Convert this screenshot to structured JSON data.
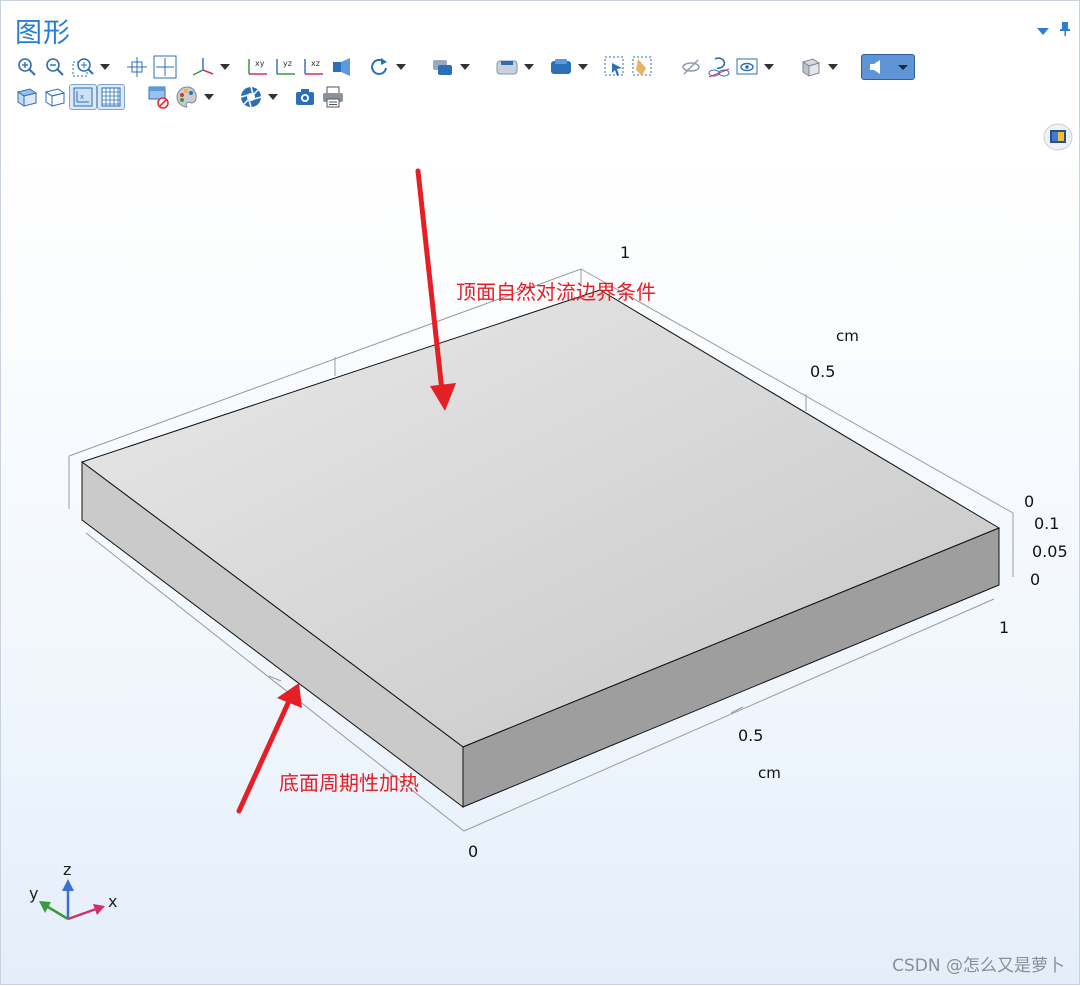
{
  "window": {
    "title": "图形"
  },
  "toolbar": {
    "row1": [
      {
        "name": "zoom-in-icon",
        "dropdown": false
      },
      {
        "name": "zoom-out-icon",
        "dropdown": false
      },
      {
        "name": "zoom-box-icon",
        "dropdown": true
      },
      {
        "name": "zoom-extents-icon",
        "dropdown": false
      },
      {
        "name": "zoom-to-selection-icon",
        "dropdown": false
      },
      {
        "name": "view-axes-icon",
        "dropdown": true
      },
      {
        "name": "view-xy-icon",
        "dropdown": false
      },
      {
        "name": "view-yz-icon",
        "dropdown": false
      },
      {
        "name": "view-xz-icon",
        "dropdown": false
      },
      {
        "name": "perspective-icon",
        "dropdown": false
      },
      {
        "name": "rotate-icon",
        "dropdown": true
      },
      {
        "name": "select-objects-icon",
        "dropdown": true
      },
      {
        "name": "select-boundaries-icon",
        "dropdown": true
      },
      {
        "name": "select-domains-icon",
        "dropdown": true
      },
      {
        "name": "box-select-icon",
        "dropdown": false
      },
      {
        "name": "clear-selection-icon",
        "dropdown": false
      },
      {
        "name": "hide-icon",
        "dropdown": false
      },
      {
        "name": "reset-hiding-icon",
        "dropdown": false
      },
      {
        "name": "show-icon",
        "dropdown": true
      },
      {
        "name": "transparency-icon",
        "dropdown": true
      },
      {
        "name": "light-icon",
        "dropdown": true,
        "selected": true
      }
    ],
    "row2": [
      {
        "name": "wireframe-icon",
        "dropdown": false
      },
      {
        "name": "render-icon",
        "dropdown": false
      },
      {
        "name": "axis-toggle-icon",
        "dropdown": false,
        "active": true
      },
      {
        "name": "grid-toggle-icon",
        "dropdown": false,
        "active": true
      },
      {
        "name": "no-clip-icon",
        "dropdown": false
      },
      {
        "name": "color-table-icon",
        "dropdown": true
      },
      {
        "name": "scene-light-icon",
        "dropdown": true
      },
      {
        "name": "camera-icon",
        "dropdown": false
      },
      {
        "name": "print-icon",
        "dropdown": false
      }
    ]
  },
  "annotations": {
    "top": "顶面自然对流边界条件",
    "bottom": "底面周期性加热"
  },
  "axes": {
    "back": {
      "ticks": [
        "1",
        "0.5",
        "0"
      ],
      "unit": "cm"
    },
    "front": {
      "ticks": [
        "1",
        "0.5",
        "0"
      ],
      "unit": "cm"
    },
    "vertical": {
      "ticks": [
        "0.1",
        "0.05",
        "0"
      ]
    }
  },
  "triad": {
    "x": "x",
    "y": "y",
    "z": "z"
  },
  "watermark": "CSDN @怎么又是萝卜",
  "colors": {
    "title": "#2a7ed3",
    "annotation": "#e51f26",
    "slab_top": "#d3d3d3",
    "slab_front": "#9e9e9e",
    "slab_left": "#cacaca"
  }
}
